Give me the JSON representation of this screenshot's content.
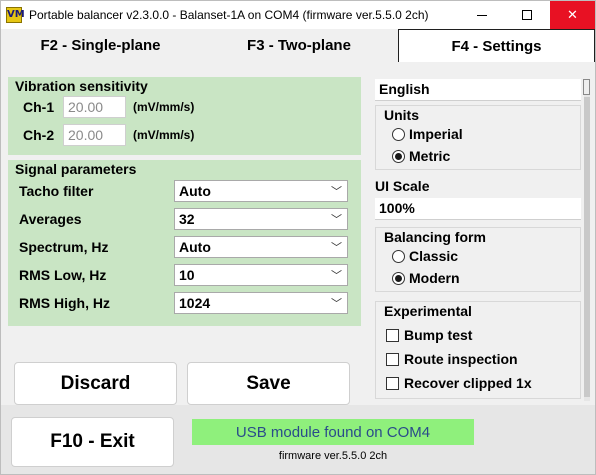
{
  "window": {
    "title": "Portable balancer v2.3.0.0 - Balanset-1A on COM4 (firmware ver.5.5.0 2ch)"
  },
  "tabs": [
    {
      "label": "F2 - Single-plane"
    },
    {
      "label": "F3 - Two-plane"
    },
    {
      "label": "F4 - Settings"
    }
  ],
  "vibration": {
    "title": "Vibration sensitivity",
    "ch1": {
      "label": "Ch-1",
      "value": "20.00",
      "unit": "(mV/mm/s)"
    },
    "ch2": {
      "label": "Ch-2",
      "value": "20.00",
      "unit": "(mV/mm/s)"
    }
  },
  "signal": {
    "title": "Signal parameters",
    "rows": [
      {
        "label": "Tacho filter",
        "value": "Auto"
      },
      {
        "label": "Averages",
        "value": "32"
      },
      {
        "label": "Spectrum, Hz",
        "value": "Auto"
      },
      {
        "label": "RMS Low, Hz",
        "value": "10"
      },
      {
        "label": "RMS High, Hz",
        "value": "1024"
      }
    ]
  },
  "buttons": {
    "discard": "Discard",
    "save": "Save",
    "exit": "F10 - Exit"
  },
  "settings": {
    "language": "English",
    "units": {
      "title": "Units",
      "imperial": "Imperial",
      "metric": "Metric",
      "selected": "Metric"
    },
    "ui_scale": {
      "label": "UI Scale",
      "value": "100%"
    },
    "balancing_form": {
      "title": "Balancing form",
      "classic": "Classic",
      "modern": "Modern",
      "selected": "Modern"
    },
    "experimental": {
      "title": "Experimental",
      "bump_test": "Bump test",
      "route_inspection": "Route inspection",
      "recover_clipped": "Recover clipped 1x"
    }
  },
  "status": {
    "message": "USB module found on COM4",
    "firmware": "firmware ver.5.5.0 2ch",
    "color": "#8ff07c"
  }
}
